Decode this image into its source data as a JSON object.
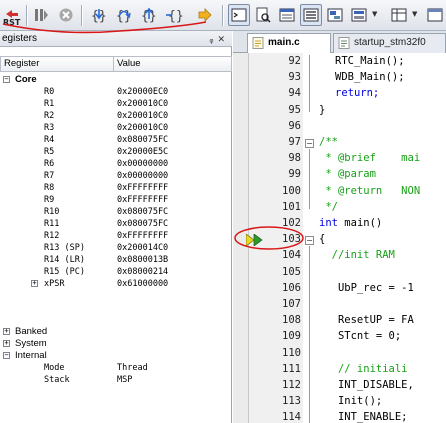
{
  "toolbar": {
    "rst_label": "RST",
    "buttons": [
      {
        "name": "reset-icon"
      },
      {
        "name": "run-icon"
      },
      {
        "name": "stop-icon"
      },
      {
        "name": "step-into-icon"
      },
      {
        "name": "step-over-icon"
      },
      {
        "name": "step-out-icon"
      },
      {
        "name": "run-to-cursor-icon"
      },
      {
        "name": "show-next-statement-icon"
      },
      {
        "name": "command-window-icon"
      },
      {
        "name": "disassembly-window-icon"
      },
      {
        "name": "symbols-window-icon"
      },
      {
        "name": "registers-window-icon"
      },
      {
        "name": "call-stack-window-icon"
      },
      {
        "name": "watch-window-icon"
      },
      {
        "name": "memory-window-icon"
      }
    ]
  },
  "registers_pane": {
    "title": "egisters",
    "pin_icon": "pin-icon",
    "close_icon": "close-icon",
    "columns": [
      "Register",
      "Value"
    ],
    "groups": {
      "core": "Core",
      "banked": "Banked",
      "system": "System",
      "internal": "Internal"
    },
    "core_registers": [
      {
        "name": "R0",
        "value": "0x20000EC0"
      },
      {
        "name": "R1",
        "value": "0x200010C0"
      },
      {
        "name": "R2",
        "value": "0x200010C0"
      },
      {
        "name": "R3",
        "value": "0x200010C0"
      },
      {
        "name": "R4",
        "value": "0x080075FC"
      },
      {
        "name": "R5",
        "value": "0x20000E5C"
      },
      {
        "name": "R6",
        "value": "0x00000000"
      },
      {
        "name": "R7",
        "value": "0x00000000"
      },
      {
        "name": "R8",
        "value": "0xFFFFFFFF"
      },
      {
        "name": "R9",
        "value": "0xFFFFFFFF"
      },
      {
        "name": "R10",
        "value": "0x080075FC"
      },
      {
        "name": "R11",
        "value": "0x080075FC"
      },
      {
        "name": "R12",
        "value": "0xFFFFFFFF"
      },
      {
        "name": "R13 (SP)",
        "value": "0x200014C0"
      },
      {
        "name": "R14 (LR)",
        "value": "0x0800013B"
      },
      {
        "name": "R15 (PC)",
        "value": "0x08000214"
      },
      {
        "name": "xPSR",
        "value": "0x61000000"
      }
    ],
    "internal_registers": [
      {
        "name": "Mode",
        "value": "Thread"
      },
      {
        "name": "Stack",
        "value": "MSP"
      }
    ]
  },
  "editor": {
    "tabs": [
      {
        "label": "main.c",
        "active": true
      },
      {
        "label": "startup_stm32f0",
        "active": false
      }
    ],
    "lines": [
      {
        "num": "92",
        "code": "RTC_Main();",
        "indent": 2,
        "cls": ""
      },
      {
        "num": "93",
        "code": "WDB_Main();",
        "indent": 2,
        "cls": ""
      },
      {
        "num": "94",
        "code": "return;",
        "indent": 2,
        "cls": "kw"
      },
      {
        "num": "95",
        "code": "}",
        "indent": 0,
        "cls": ""
      },
      {
        "num": "96",
        "code": "",
        "indent": 0,
        "cls": ""
      },
      {
        "num": "97",
        "code": "/**",
        "indent": 0,
        "cls": "doc"
      },
      {
        "num": "98",
        "code": " * @brief    mai",
        "indent": 0,
        "cls": "doc"
      },
      {
        "num": "99",
        "code": " * @param",
        "indent": 0,
        "cls": "doc"
      },
      {
        "num": "100",
        "code": " * @return   NON",
        "indent": 0,
        "cls": "doc"
      },
      {
        "num": "101",
        "code": " */",
        "indent": 0,
        "cls": "doc"
      },
      {
        "num": "102",
        "code": "int main()",
        "indent": 0,
        "cls": "kwint"
      },
      {
        "num": "103",
        "code": "{",
        "indent": 0,
        "cls": ""
      },
      {
        "num": "104",
        "code": "  //init RAM",
        "indent": 0,
        "cls": "cmt"
      },
      {
        "num": "105",
        "code": "",
        "indent": 0,
        "cls": ""
      },
      {
        "num": "106",
        "code": "   UbP_rec = -1",
        "indent": 0,
        "cls": ""
      },
      {
        "num": "107",
        "code": "",
        "indent": 0,
        "cls": ""
      },
      {
        "num": "108",
        "code": "   ResetUP = FA",
        "indent": 0,
        "cls": ""
      },
      {
        "num": "109",
        "code": "   STcnt = 0;",
        "indent": 0,
        "cls": ""
      },
      {
        "num": "110",
        "code": "",
        "indent": 0,
        "cls": ""
      },
      {
        "num": "111",
        "code": "   // initiali",
        "indent": 0,
        "cls": "cmt"
      },
      {
        "num": "112",
        "code": "   INT_DISABLE,",
        "indent": 0,
        "cls": ""
      },
      {
        "num": "113",
        "code": "   Init();",
        "indent": 0,
        "cls": ""
      },
      {
        "num": "114",
        "code": "   INT_ENABLE;",
        "indent": 0,
        "cls": ""
      }
    ],
    "current_line": "103"
  },
  "colors": {
    "annotation_red": "#d81818",
    "comment_green": "#18a018",
    "keyword_blue": "#0000e0",
    "debug_arrow_yellow": "#e8d820",
    "debug_arrow_green": "#2a9a2a"
  }
}
